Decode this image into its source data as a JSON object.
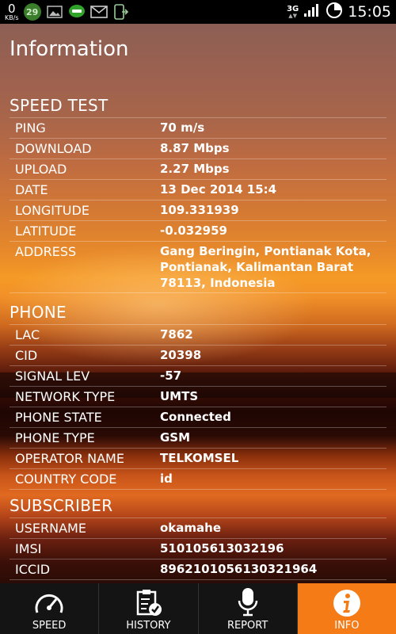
{
  "status_bar": {
    "speed_value": "0",
    "speed_unit": "KB/s",
    "badge_count": "29",
    "network_type": "3G",
    "time": "15:05"
  },
  "page_title": "Information",
  "speed_test": {
    "title": "SPEED TEST",
    "rows": [
      {
        "label": "PING",
        "value": "70 m/s"
      },
      {
        "label": "DOWNLOAD",
        "value": "8.87 Mbps"
      },
      {
        "label": "UPLOAD",
        "value": "2.27 Mbps"
      },
      {
        "label": "DATE",
        "value": "13 Dec 2014 15:4"
      },
      {
        "label": "LONGITUDE",
        "value": "109.331939"
      },
      {
        "label": "LATITUDE",
        "value": "-0.032959"
      },
      {
        "label": "ADDRESS",
        "value": "Gang Beringin, Pontianak Kota, Pontianak, Kalimantan Barat 78113, Indonesia"
      }
    ]
  },
  "phone": {
    "title": "PHONE",
    "rows": [
      {
        "label": "LAC",
        "value": "7862"
      },
      {
        "label": "CID",
        "value": "20398"
      },
      {
        "label": "SIGNAL LEV",
        "value": "-57"
      },
      {
        "label": "NETWORK TYPE",
        "value": "UMTS"
      },
      {
        "label": "PHONE STATE",
        "value": "Connected"
      },
      {
        "label": "PHONE TYPE",
        "value": "GSM"
      },
      {
        "label": "OPERATOR NAME",
        "value": "TELKOMSEL"
      },
      {
        "label": "COUNTRY CODE",
        "value": "id"
      }
    ]
  },
  "subscriber": {
    "title": "SUBSCRIBER",
    "rows": [
      {
        "label": "USERNAME",
        "value": "okamahe"
      },
      {
        "label": "IMSI",
        "value": "510105613032196"
      },
      {
        "label": "ICCID",
        "value": "8962101056130321964"
      }
    ]
  },
  "nav": {
    "tabs": [
      {
        "label": "SPEED",
        "icon": "speedometer-icon"
      },
      {
        "label": "HISTORY",
        "icon": "clipboard-check-icon"
      },
      {
        "label": "REPORT",
        "icon": "microphone-icon"
      },
      {
        "label": "INFO",
        "icon": "info-icon",
        "active": true
      }
    ]
  },
  "colors": {
    "accent": "#f47b16",
    "nav_background": "#141414",
    "status_bar": "#000000"
  }
}
